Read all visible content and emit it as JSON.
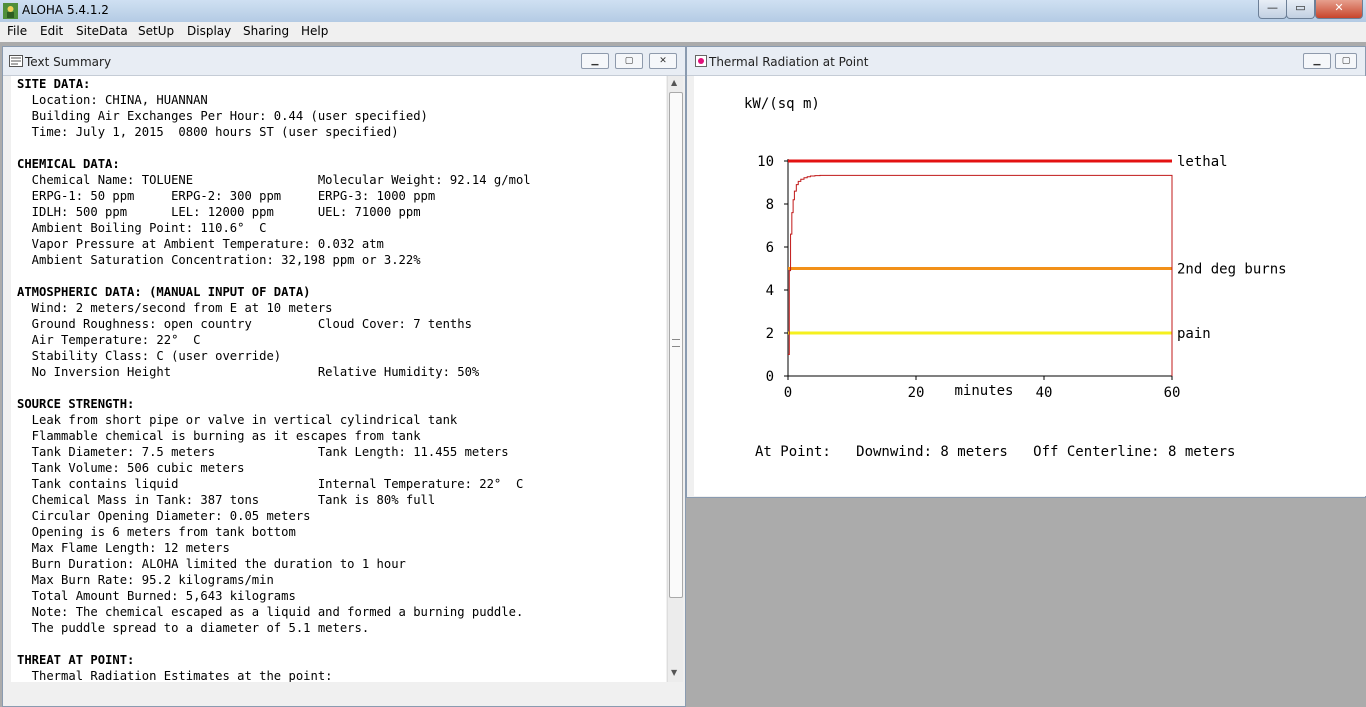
{
  "app": {
    "title": "ALOHA 5.4.1.2",
    "window_controls": {
      "minimize": "—",
      "maximize": "▭",
      "close": "✕"
    }
  },
  "menu": [
    "File",
    "Edit",
    "SiteData",
    "SetUp",
    "Display",
    "Sharing",
    "Help"
  ],
  "text_summary": {
    "title": "Text Summary",
    "lines": [
      {
        "t": "SITE DATA:",
        "b": true
      },
      {
        "t": "  Location: CHINA, HUANNAN"
      },
      {
        "t": "  Building Air Exchanges Per Hour: 0.44 (user specified)"
      },
      {
        "t": "  Time: July 1, 2015  0800 hours ST (user specified)"
      },
      {
        "t": ""
      },
      {
        "t": "CHEMICAL DATA:",
        "b": true
      },
      {
        "t": "  Chemical Name: TOLUENE                 Molecular Weight: 92.14 g/mol"
      },
      {
        "t": "  ERPG-1: 50 ppm     ERPG-2: 300 ppm     ERPG-3: 1000 ppm"
      },
      {
        "t": "  IDLH: 500 ppm      LEL: 12000 ppm      UEL: 71000 ppm"
      },
      {
        "t": "  Ambient Boiling Point: 110.6°  C"
      },
      {
        "t": "  Vapor Pressure at Ambient Temperature: 0.032 atm"
      },
      {
        "t": "  Ambient Saturation Concentration: 32,198 ppm or 3.22%"
      },
      {
        "t": ""
      },
      {
        "t": "ATMOSPHERIC DATA: (MANUAL INPUT OF DATA)",
        "b": true
      },
      {
        "t": "  Wind: 2 meters/second from E at 10 meters"
      },
      {
        "t": "  Ground Roughness: open country         Cloud Cover: 7 tenths"
      },
      {
        "t": "  Air Temperature: 22°  C"
      },
      {
        "t": "  Stability Class: C (user override)"
      },
      {
        "t": "  No Inversion Height                    Relative Humidity: 50%"
      },
      {
        "t": ""
      },
      {
        "t": "SOURCE STRENGTH:",
        "b": true
      },
      {
        "t": "  Leak from short pipe or valve in vertical cylindrical tank"
      },
      {
        "t": "  Flammable chemical is burning as it escapes from tank"
      },
      {
        "t": "  Tank Diameter: 7.5 meters              Tank Length: 11.455 meters"
      },
      {
        "t": "  Tank Volume: 506 cubic meters"
      },
      {
        "t": "  Tank contains liquid                   Internal Temperature: 22°  C"
      },
      {
        "t": "  Chemical Mass in Tank: 387 tons        Tank is 80% full"
      },
      {
        "t": "  Circular Opening Diameter: 0.05 meters"
      },
      {
        "t": "  Opening is 6 meters from tank bottom"
      },
      {
        "t": "  Max Flame Length: 12 meters"
      },
      {
        "t": "  Burn Duration: ALOHA limited the duration to 1 hour"
      },
      {
        "t": "  Max Burn Rate: 95.2 kilograms/min"
      },
      {
        "t": "  Total Amount Burned: 5,643 kilograms"
      },
      {
        "t": "  Note: The chemical escaped as a liquid and formed a burning puddle."
      },
      {
        "t": "  The puddle spread to a diameter of 5.1 meters."
      },
      {
        "t": ""
      },
      {
        "t": "THREAT AT POINT:",
        "b": true
      },
      {
        "t": "  Thermal Radiation Estimates at the point:"
      }
    ]
  },
  "thermal": {
    "title": "Thermal Radiation at Point",
    "footer": "At Point:   Downwind: 8 meters   Off Centerline: 8 meters"
  },
  "chart_data": {
    "type": "line",
    "ylabel": "kW/(sq m)",
    "xlabel": "minutes",
    "xlim": [
      0,
      60
    ],
    "ylim": [
      0,
      10
    ],
    "xticks": [
      0,
      20,
      40,
      60
    ],
    "yticks": [
      0,
      2,
      4,
      6,
      8,
      10
    ],
    "grid": false,
    "series": [
      {
        "name": "lethal",
        "color": "#e31212",
        "x": [
          0,
          60
        ],
        "y": [
          10,
          10
        ]
      },
      {
        "name": "2nd deg burns",
        "color": "#f29018",
        "x": [
          0,
          60
        ],
        "y": [
          5,
          5
        ]
      },
      {
        "name": "pain",
        "color": "#f5f01e",
        "x": [
          0,
          60
        ],
        "y": [
          2,
          2
        ]
      },
      {
        "color": "#c01818",
        "x": [
          0,
          0.2,
          0.4,
          0.6,
          0.8,
          1.0,
          1.3,
          1.6,
          2.0,
          2.5,
          3.0,
          3.5,
          4.2,
          5.0,
          60,
          60
        ],
        "y": [
          1.0,
          4.9,
          6.6,
          7.6,
          8.2,
          8.6,
          8.9,
          9.05,
          9.15,
          9.22,
          9.27,
          9.3,
          9.32,
          9.33,
          9.33,
          0
        ]
      }
    ]
  }
}
